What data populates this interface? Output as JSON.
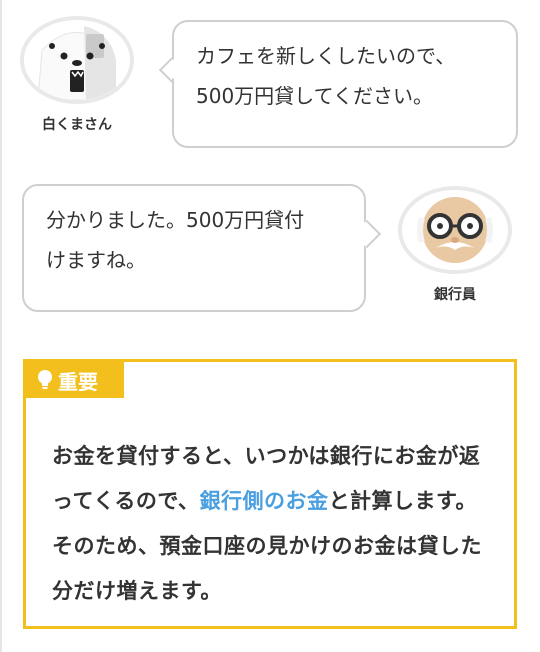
{
  "chat": [
    {
      "speaker": "白くまさん",
      "message_line1": "カフェを新しくしたいので、",
      "message_line2": "500万円貸してください。"
    },
    {
      "speaker": "銀行員",
      "message_line1": "分かりました。500万円貸付",
      "message_line2": "けますね。"
    }
  ],
  "important": {
    "label": "重要",
    "text_before": "お金を貸付すると、いつかは銀行にお金が返ってくるので、",
    "highlight": "銀行側のお金",
    "text_after": "と計算します。そのため、預金口座の見かけのお金は貸した分だけ増えます。"
  },
  "colors": {
    "accent": "#f2bf1c",
    "highlight": "#4a9fe0",
    "bubble_border": "#cfcfcf"
  },
  "icons": [
    "polar-bear-avatar",
    "banker-avatar",
    "lightbulb-icon"
  ]
}
